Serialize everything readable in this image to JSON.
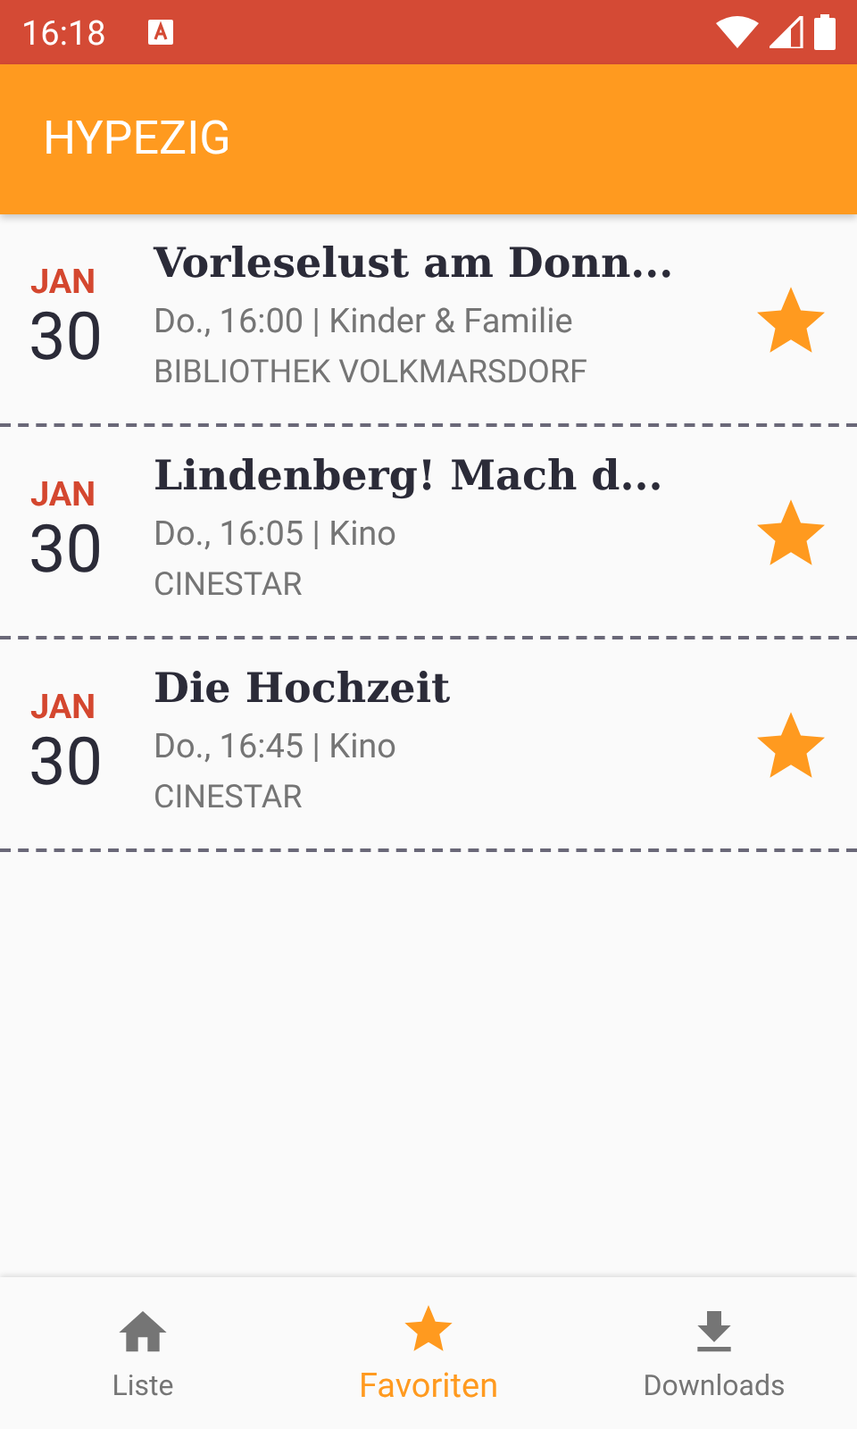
{
  "status_bar": {
    "time": "16:18"
  },
  "app_bar": {
    "title": "HYPEZIG"
  },
  "events": [
    {
      "month": "JAN",
      "day": "30",
      "title": "Vorleselust am Donn...",
      "details": "Do., 16:00 | Kinder & Familie",
      "venue": "BIBLIOTHEK VOLKMARSDORF",
      "favorite": true
    },
    {
      "month": "JAN",
      "day": "30",
      "title": "Lindenberg! Mach d...",
      "details": "Do., 16:05 | Kino",
      "venue": "CINESTAR",
      "favorite": true
    },
    {
      "month": "JAN",
      "day": "30",
      "title": "Die Hochzeit",
      "details": "Do., 16:45 | Kino",
      "venue": "CINESTAR",
      "favorite": true
    }
  ],
  "bottom_nav": [
    {
      "kind": "home",
      "label": "Liste",
      "selected": false
    },
    {
      "kind": "star",
      "label": "Favoriten",
      "selected": true
    },
    {
      "kind": "download",
      "label": "Downloads",
      "selected": false
    }
  ]
}
